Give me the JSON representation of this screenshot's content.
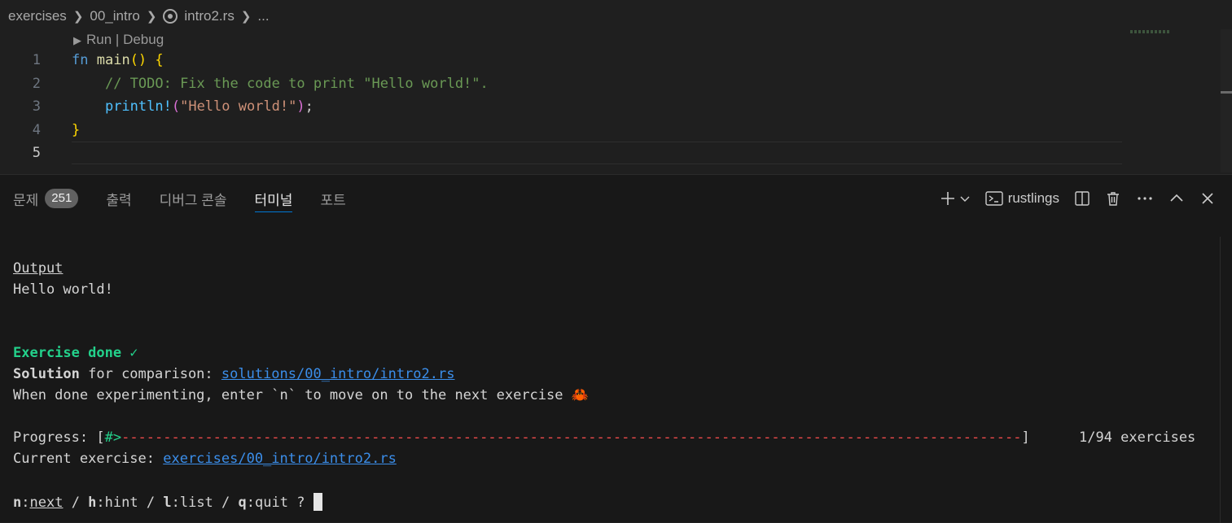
{
  "breadcrumb": {
    "parts": [
      "exercises",
      "00_intro",
      "intro2.rs",
      "..."
    ]
  },
  "editor": {
    "codelens": {
      "run": "Run",
      "sep": " | ",
      "debug": "Debug"
    },
    "line_numbers": [
      "1",
      "2",
      "3",
      "4",
      "5"
    ],
    "code": {
      "l1_kw": "fn",
      "l1_name": "main",
      "l1_paren": "()",
      "l1_brace": "{",
      "l2_comment": "// TODO: Fix the code to print \"Hello world!\".",
      "l3_macro": "println!",
      "l3_open": "(",
      "l3_str": "\"Hello world!\"",
      "l3_close": ")",
      "l3_semi": ";",
      "l4_brace": "}"
    }
  },
  "panel": {
    "tabs": [
      {
        "label": "문제",
        "badge": "251"
      },
      {
        "label": "출력"
      },
      {
        "label": "디버그 콘솔"
      },
      {
        "label": "터미널"
      },
      {
        "label": "포트"
      }
    ],
    "active_tab": "터미널",
    "terminal_name": "rustlings",
    "icons": [
      "add-icon",
      "chevron-down-icon",
      "terminal-icon",
      "split-icon",
      "trash-icon",
      "more-icon",
      "chevron-up-icon",
      "close-icon"
    ]
  },
  "terminal": {
    "output_heading": "Output",
    "output_text": "Hello world!",
    "done": "Exercise done ✓",
    "solution_bold": "Solution",
    "solution_rest": " for comparison: ",
    "solution_link": "solutions/00_intro/intro2.rs",
    "when_done": "When done experimenting, enter `n` to move on to the next exercise 🦀",
    "progress_label": "Progress: [",
    "progress_done": "#>",
    "progress_rest": "------------------------------------------------------------------------------------------------------------",
    "progress_close": "]",
    "progress_count": "1/94 exercises",
    "progress_fraction": 0.0106,
    "current_label": "Current exercise: ",
    "current_link": "exercises/00_intro/intro2.rs",
    "prompt": {
      "n": "n",
      "next": "next",
      "sep1": " / ",
      "h": "h",
      "hint": "hint",
      "sep2": " / ",
      "l": "l",
      "list": "list",
      "sep3": " / ",
      "q": "q",
      "quit": "quit",
      "tail": " ? "
    }
  },
  "colors": {
    "background": "#1f1f1f",
    "panel": "#181818",
    "accent": "#0078d4",
    "success": "#23d18b",
    "link": "#3b8eea",
    "progress_dash": "#f14c4c"
  }
}
